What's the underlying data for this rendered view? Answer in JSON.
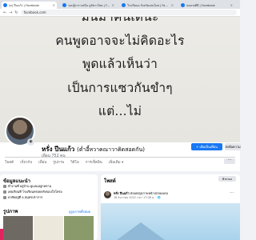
{
  "browser": {
    "tabs": [
      {
        "label": "(ต) ปีนแก้ว | Facebook",
        "active": true
      },
      {
        "label": "รอบรู้ดาราเหนือ ภูมิชาวไทย | Facebook",
        "active": false
      },
      {
        "label": "โรงเรียนอ จังหวัดเด่นโมท | Facebook",
        "active": false
      },
      {
        "label": "ของกลดีดี | Facebook",
        "active": false
      }
    ],
    "url": "facebook.com"
  },
  "cover": {
    "lines": [
      "มันมาคนเดนะ",
      "คนพูดอาจจะไม่คิดอะไร",
      "พูดแล้วเห็นว่า",
      "เป็นการแซวกันขำๆ",
      "แต่...ไม่"
    ]
  },
  "profile": {
    "name": "หรั่ง ปีนแก้ว",
    "alias": "(ต่ำอี้หวาคณาวาคิดสอดกัน)",
    "friends": "เพื่อน 752 คน",
    "add_friend": "เพิ่มเป็นเพื่อน",
    "message": "ส่งข้อความ",
    "tabs": [
      "โพสต์",
      "เกี่ยวกับ",
      "เพื่อน",
      "รูปภาพ",
      "วิดีโอ",
      "การเช็คอิน",
      "เพิ่มเติม ▾"
    ],
    "more": "···"
  },
  "intro": {
    "title": "ข้อมูลแนะนำ",
    "items": [
      "ทำงานที่ อยู่บ้าน ดูแลแม่ลูกหลาน",
      "เคยเรียนที่ โรงเรียนหรอยหรั่งขอบใจโหรอ",
      "อาศัยอยู่ที่ อ.สมุทรปราการ"
    ]
  },
  "photos": {
    "title": "รูปภาพ",
    "link": "ดูรูปภาพทั้งหมด"
  },
  "posts": {
    "title": "โพสต์",
    "filter": "ตัวกรอง",
    "author": "หรั่ง ปีนแก้ว",
    "author_suffix": "อัปเดตรูปภาพหน้าปกของเธอ",
    "time": "16 ธันวาคม 2022 เวลา 17:08 น. · 🌐",
    "dots": "···"
  },
  "colors": {
    "brand": "#1877f2",
    "page_bg": "#f0f2f5",
    "cover_bg": "#ecebe6"
  }
}
